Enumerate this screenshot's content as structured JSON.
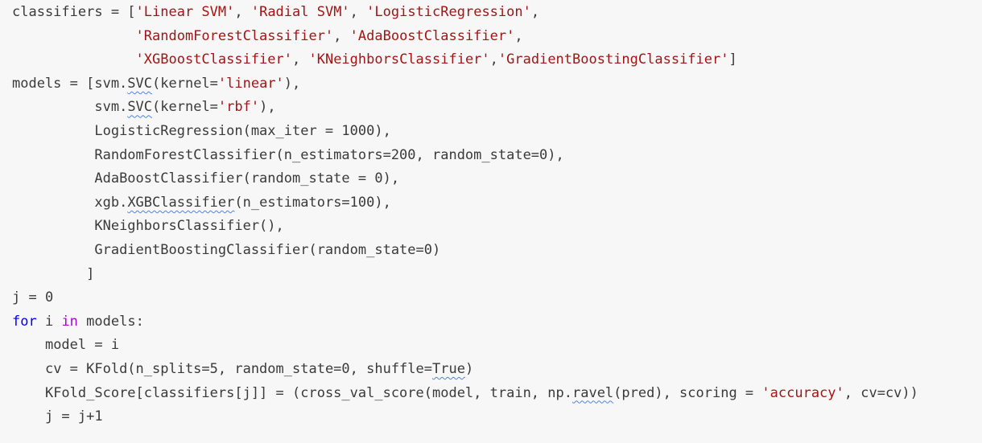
{
  "lines": [
    {
      "indent": "",
      "tokens": [
        {
          "t": "classifiers = [",
          "c": ""
        },
        {
          "t": "'Linear SVM'",
          "c": "str"
        },
        {
          "t": ", ",
          "c": ""
        },
        {
          "t": "'Radial SVM'",
          "c": "str"
        },
        {
          "t": ", ",
          "c": ""
        },
        {
          "t": "'LogisticRegression'",
          "c": "str"
        },
        {
          "t": ",",
          "c": ""
        }
      ]
    },
    {
      "indent": "               ",
      "tokens": [
        {
          "t": "'RandomForestClassifier'",
          "c": "str"
        },
        {
          "t": ", ",
          "c": ""
        },
        {
          "t": "'AdaBoostClassifier'",
          "c": "str"
        },
        {
          "t": ",",
          "c": ""
        }
      ]
    },
    {
      "indent": "               ",
      "tokens": [
        {
          "t": "'XGBoostClassifier'",
          "c": "str"
        },
        {
          "t": ", ",
          "c": ""
        },
        {
          "t": "'KNeighborsClassifier'",
          "c": "str"
        },
        {
          "t": ",",
          "c": ""
        },
        {
          "t": "'GradientBoostingClassifier'",
          "c": "str"
        },
        {
          "t": "]",
          "c": ""
        }
      ]
    },
    {
      "indent": "",
      "tokens": [
        {
          "t": "models = [svm.",
          "c": ""
        },
        {
          "t": "SVC",
          "c": "squig"
        },
        {
          "t": "(kernel=",
          "c": ""
        },
        {
          "t": "'linear'",
          "c": "str"
        },
        {
          "t": "),",
          "c": ""
        }
      ]
    },
    {
      "indent": "          ",
      "tokens": [
        {
          "t": "svm.",
          "c": ""
        },
        {
          "t": "SVC",
          "c": "squig"
        },
        {
          "t": "(kernel=",
          "c": ""
        },
        {
          "t": "'rbf'",
          "c": "str"
        },
        {
          "t": "),",
          "c": ""
        }
      ]
    },
    {
      "indent": "          ",
      "tokens": [
        {
          "t": "LogisticRegression(max_iter = 1000),",
          "c": ""
        }
      ]
    },
    {
      "indent": "          ",
      "tokens": [
        {
          "t": "RandomForestClassifier(n_estimators=200, random_state=0),",
          "c": ""
        }
      ]
    },
    {
      "indent": "          ",
      "tokens": [
        {
          "t": "AdaBoostClassifier(random_state = 0),",
          "c": ""
        }
      ]
    },
    {
      "indent": "          ",
      "tokens": [
        {
          "t": "xgb.",
          "c": ""
        },
        {
          "t": "XGBClassifier",
          "c": "squig"
        },
        {
          "t": "(n_estimators=100),",
          "c": ""
        }
      ]
    },
    {
      "indent": "          ",
      "tokens": [
        {
          "t": "KNeighborsClassifier(),",
          "c": ""
        }
      ]
    },
    {
      "indent": "          ",
      "tokens": [
        {
          "t": "GradientBoostingClassifier(random_state=0)",
          "c": ""
        }
      ]
    },
    {
      "indent": "         ",
      "tokens": [
        {
          "t": "]",
          "c": ""
        }
      ]
    },
    {
      "indent": "",
      "tokens": [
        {
          "t": "j = 0",
          "c": ""
        }
      ]
    },
    {
      "indent": "",
      "tokens": [
        {
          "t": "for",
          "c": "kw"
        },
        {
          "t": " i ",
          "c": ""
        },
        {
          "t": "in",
          "c": "kw2"
        },
        {
          "t": " models:",
          "c": ""
        }
      ]
    },
    {
      "indent": "    ",
      "tokens": [
        {
          "t": "model = i",
          "c": ""
        }
      ]
    },
    {
      "indent": "    ",
      "tokens": [
        {
          "t": "cv = KFold(n_splits=5, random_state=0, shuffle=",
          "c": ""
        },
        {
          "t": "True",
          "c": "squig"
        },
        {
          "t": ")",
          "c": ""
        }
      ]
    },
    {
      "indent": "    ",
      "tokens": [
        {
          "t": "KFold_Score[classifiers[j]] = (cross_val_score(model, train, np.",
          "c": ""
        },
        {
          "t": "ravel",
          "c": "squig"
        },
        {
          "t": "(pred), scoring = ",
          "c": ""
        },
        {
          "t": "'accuracy'",
          "c": "str"
        },
        {
          "t": ", cv=cv))",
          "c": ""
        }
      ]
    },
    {
      "indent": "    ",
      "tokens": [
        {
          "t": "j = j+1",
          "c": ""
        }
      ]
    }
  ]
}
